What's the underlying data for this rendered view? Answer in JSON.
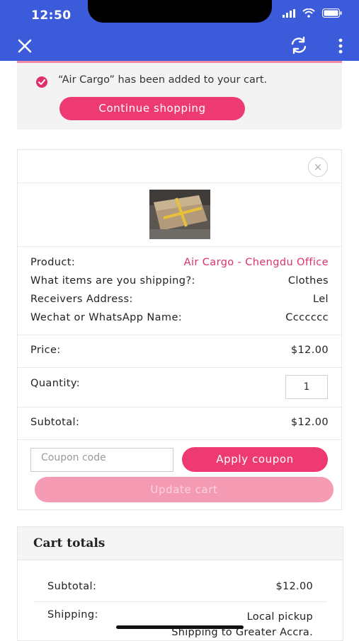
{
  "status_bar": {
    "time": "12:50"
  },
  "toolbar": {
    "close_icon": "close-icon",
    "refresh_icon": "refresh-icon",
    "more_icon": "more-vertical-icon"
  },
  "notice": {
    "message": "“Air Cargo” has been added to your cart.",
    "continue_label": "Continue shopping"
  },
  "cart_item": {
    "remove_symbol": "×",
    "rows": [
      {
        "label": "Product:",
        "value": "Air Cargo - Chengdu Office"
      },
      {
        "label": "What items are you shipping?:",
        "value": "Clothes"
      },
      {
        "label": "Receivers Address:",
        "value": "Lel"
      },
      {
        "label": "Wechat or WhatsApp Name:",
        "value": "Ccccccc"
      }
    ],
    "price_label": "Price:",
    "price_value": "$12.00",
    "quantity_label": "Quantity:",
    "quantity_value": "1",
    "subtotal_label": "Subtotal:",
    "subtotal_value": "$12.00"
  },
  "coupon": {
    "placeholder": "Coupon code",
    "apply_label": "Apply coupon",
    "update_label": "Update cart"
  },
  "totals": {
    "title": "Cart totals",
    "subtotal_label": "Subtotal:",
    "subtotal_value": "$12.00",
    "shipping_label": "Shipping:",
    "shipping_method": "Local pickup",
    "shipping_to": "Shipping to Greater Accra."
  },
  "colors": {
    "app_bar": "#3b5bdb",
    "accent": "#ee3a72",
    "accent_disabled": "#f59ab3"
  }
}
